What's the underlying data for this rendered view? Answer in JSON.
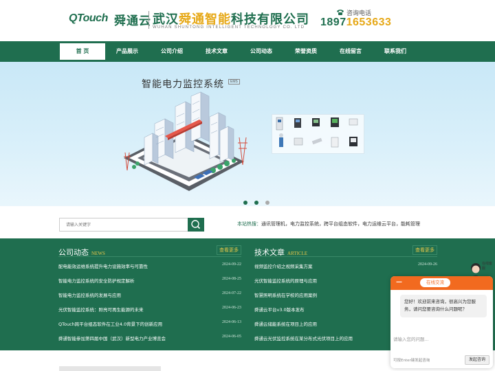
{
  "header": {
    "logo_q": "QTouch",
    "logo_cn": "舜通云",
    "company_pre": "武汉",
    "company_hl": "舜通智能",
    "company_post": "科技有限公司",
    "company_en": "WUHAN SHUNTONG INTELLIGENT TECHNOLOGY CO. LTD",
    "phone_label": "咨询电话",
    "phone_a": "1897",
    "phone_b": "1653633",
    "brand_color": "#1f6e4f",
    "accent_color": "#e6a817"
  },
  "nav": {
    "items": [
      {
        "label": "首 页"
      },
      {
        "label": "产品展示"
      },
      {
        "label": "公司介绍"
      },
      {
        "label": "技术文章"
      },
      {
        "label": "公司动态"
      },
      {
        "label": "荣誉资质"
      },
      {
        "label": "在线留言"
      },
      {
        "label": "联系我们"
      }
    ],
    "active_index": 0
  },
  "banner": {
    "title": "智能电力监控系统",
    "tag": "EMS"
  },
  "search": {
    "placeholder": "请输入关键字",
    "hot_label": "本站热搜：",
    "hot_terms": "通讯管理机，电力监控系统，跨平台组态软件，电力运维云平台，能耗管理"
  },
  "news_left": {
    "title": "公司动态",
    "title_en": "NEWS",
    "more": "查看更多",
    "items": [
      {
        "title": "配电能效运维系统提升电力设施效率与可靠性",
        "date": "2024-09-22"
      },
      {
        "title": "智能电力监控系统的安全防护规定解析",
        "date": "2024-08-25"
      },
      {
        "title": "智能电力监控系统的发展与应用",
        "date": "2024-07-22"
      },
      {
        "title": "光伏智能监控系统：照亮可再生能源的未来",
        "date": "2024-06-23"
      },
      {
        "title": "QTouch跨平台组态软件在工业4.0背景下的创新应用",
        "date": "2024-06-13"
      },
      {
        "title": "舜通智能参加第四届中国（武汉）新型电力产业博览会",
        "date": "2024-06-05"
      }
    ]
  },
  "news_right": {
    "title": "技术文章",
    "title_en": "ARTICLE",
    "more": "查看更多",
    "items": [
      {
        "title": "视频监控介绍之视频采集方案",
        "date": "2024-09-26"
      },
      {
        "title": "光伏智能监控系统的原理与应用",
        "date": ""
      },
      {
        "title": "智慧照明系统在学校的应用案例",
        "date": ""
      },
      {
        "title": "舜通云平台v3.0版本发布",
        "date": ""
      },
      {
        "title": "舜通云储能系统在项目上的应用",
        "date": ""
      },
      {
        "title": "舜通云光伏监控系统在某分布式光伏项目上的应用",
        "date": ""
      }
    ]
  },
  "chat": {
    "minimize": "—",
    "title": "在线交流",
    "greeting": "您好！欢迎前来咨询，很高兴为您服务，请问您要咨询什么问题呢？",
    "input_placeholder": "请输入您的问题...",
    "hint": "可按Enter键发起咨询",
    "send": "发起咨询",
    "side_tag": "在线客服",
    "header_color": "#f26a1f"
  }
}
